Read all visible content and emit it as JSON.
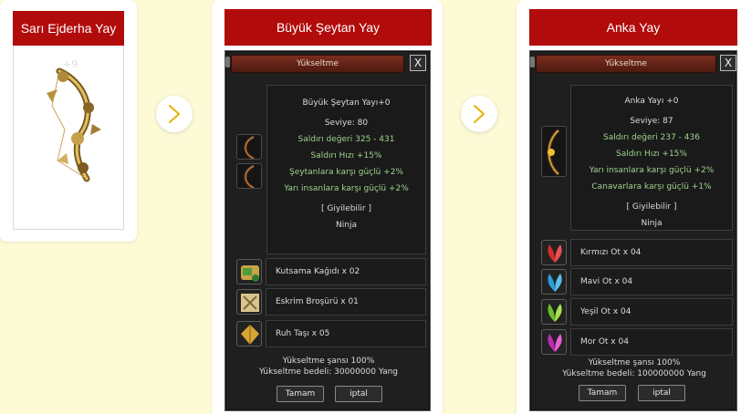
{
  "cards": [
    {
      "title": "Sarı Ejderha Yay",
      "plus_label": "+9"
    },
    {
      "title": "Büyük Şeytan Yay",
      "window_title": "Yükseltme",
      "close_label": "X",
      "item_name": "Büyük Şeytan Yayı+0",
      "level": "Seviye: 80",
      "stats": [
        "Saldırı değeri 325 - 431",
        "Saldırı Hızı +15%",
        "Şeytanlara karşı güçlü +2%",
        "Yarı insanlara karşı güçlü +2%"
      ],
      "wearable": "[ Giyilebilir ]",
      "class": "Ninja",
      "materials": [
        "Kutsama Kağıdı x 02",
        "Eskrim Broşürü x 01",
        "Ruh Taşı x 05"
      ],
      "chance": "Yükseltme şansı 100%",
      "cost": "Yükseltme bedeli: 30000000 Yang",
      "ok_label": "Tamam",
      "cancel_label": "iptal"
    },
    {
      "title": "Anka Yay",
      "window_title": "Yükseltme",
      "close_label": "X",
      "item_name": "Anka Yayı +0",
      "level": "Seviye: 87",
      "stats": [
        "Saldırı değeri 237 - 436",
        "Saldırı Hızı +15%",
        "Yarı insanlara karşı güçlü +2%",
        "Canavarlara karşı güçlü +1%"
      ],
      "wearable": "[ Giyilebilir ]",
      "class": "Ninja",
      "materials": [
        "Kırmızı Ot x 04",
        "Mavi Ot x 04",
        "Yeşil Ot x 04",
        "Mor Ot x 04"
      ],
      "chance": "Yükseltme şansı 100%",
      "cost": "Yükseltme bedeli: 100000000 Yang",
      "ok_label": "Tamam",
      "cancel_label": "iptal"
    }
  ],
  "icons": {
    "arrow": "chevron-right-icon",
    "card2_materials": [
      "blessing-scroll-icon",
      "fencing-brochure-icon",
      "spirit-stone-icon"
    ],
    "card3_materials": [
      "red-herb-icon",
      "blue-herb-icon",
      "green-herb-icon",
      "purple-herb-icon"
    ]
  },
  "colors": {
    "page_bg": "#fdfbd6",
    "title_red": "#b10b0b",
    "stat_green": "#9ed38e",
    "window_dark": "#1f1f1f",
    "titlebar_brown": "#6a2618",
    "arrow_gold": "#e8b000"
  }
}
